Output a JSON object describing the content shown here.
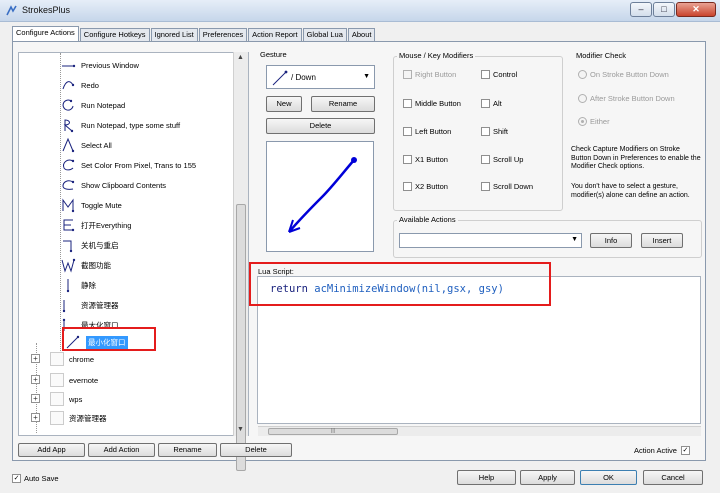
{
  "window": {
    "title": "StrokesPlus",
    "controls": {
      "minimize": "–",
      "maximize": "□",
      "close": "✕"
    }
  },
  "tabs": [
    "Configure Actions",
    "Configure Hotkeys",
    "Ignored List",
    "Preferences",
    "Action Report",
    "Global Lua",
    "About"
  ],
  "tree": {
    "items": [
      {
        "label": "Previous Window",
        "icon": "gesture-line-icon"
      },
      {
        "label": "Redo",
        "icon": "gesture-curve-icon"
      },
      {
        "label": "Run Notepad",
        "icon": "gesture-circle-icon"
      },
      {
        "label": "Run Notepad, type some stuff",
        "icon": "gesture-r-icon"
      },
      {
        "label": "Select All",
        "icon": "gesture-a-icon"
      },
      {
        "label": "Set Color From Pixel, Trans to 155",
        "icon": "gesture-c-icon"
      },
      {
        "label": "Show Clipboard Contents",
        "icon": "gesture-c-icon"
      },
      {
        "label": "Toggle Mute",
        "icon": "gesture-m-icon"
      },
      {
        "label": "打开Everything",
        "icon": "gesture-e-icon"
      },
      {
        "label": "关机与重启",
        "icon": "gesture-l-icon"
      },
      {
        "label": "截图功能",
        "icon": "gesture-w-icon"
      },
      {
        "label": "静除",
        "icon": "gesture-s-icon"
      },
      {
        "label": "资源管理器",
        "icon": "gesture-down-icon"
      },
      {
        "label": "最大化窗口",
        "icon": "gesture-up-icon"
      },
      {
        "label": "最小化窗口",
        "icon": "gesture-diag-icon",
        "selected": true
      }
    ],
    "groups": [
      "chrome",
      "evernote",
      "wps",
      "资源管理器"
    ]
  },
  "gesture": {
    "label": "Gesture",
    "selected": "/ Down",
    "new_label": "New",
    "rename_label": "Rename",
    "delete_label": "Delete"
  },
  "modifiers": {
    "title": "Mouse / Key Modifiers",
    "col1": [
      "Right Button",
      "Middle Button",
      "Left Button",
      "X1 Button",
      "X2 Button"
    ],
    "col2": [
      "Control",
      "Alt",
      "Shift",
      "Scroll Up",
      "Scroll Down"
    ]
  },
  "modifier_check": {
    "title": "Modifier Check",
    "options": [
      "On Stroke Button Down",
      "After Stroke Button Down",
      "Either"
    ],
    "note1": "Check Capture Modifiers on Stroke Button Down in Preferences to enable the Modifier Check options.",
    "note2": "You don't have to select a gesture, modifier(s) alone can define an action."
  },
  "available_actions": {
    "title": "Available Actions",
    "value": "",
    "info_label": "Info",
    "insert_label": "Insert"
  },
  "lua": {
    "label": "Lua Script:",
    "keyword": "return",
    "code": " acMinimizeWindow(nil,gsx, gsy)"
  },
  "bottom": {
    "add_app": "Add App",
    "add_action": "Add Action",
    "rename": "Rename",
    "delete": "Delete",
    "action_active": "Action Active",
    "auto_save": "Auto Save",
    "help": "Help",
    "apply": "Apply",
    "ok": "OK",
    "cancel": "Cancel"
  },
  "colors": {
    "highlight": "#e41c1c",
    "selection": "#3399ff",
    "code": "#1f5fbf",
    "gesture_stroke": "#0000d8"
  }
}
